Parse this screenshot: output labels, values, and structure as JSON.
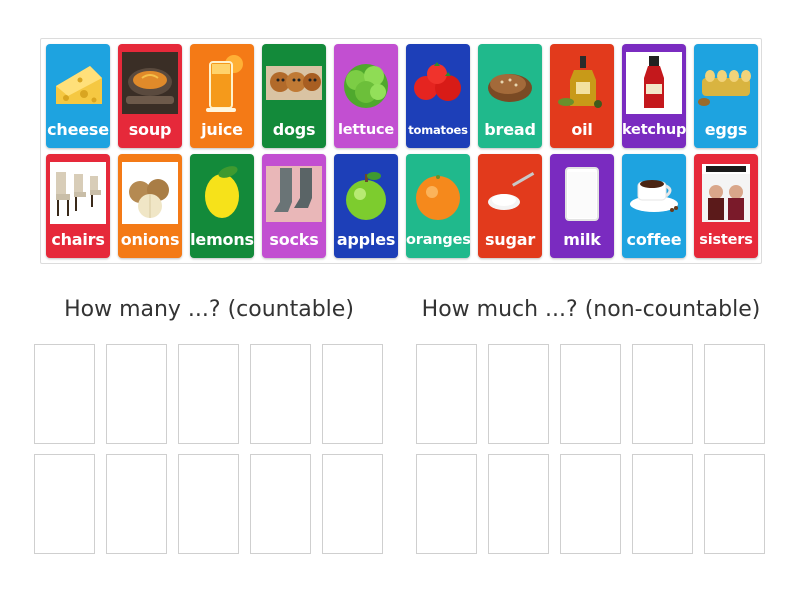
{
  "cards": [
    {
      "label": "cheese",
      "color": "#1ea3e0",
      "icon": "cheese-icon"
    },
    {
      "label": "soup",
      "color": "#e6293a",
      "icon": "soup-bowl-icon"
    },
    {
      "label": "juice",
      "color": "#f47a16",
      "icon": "juice-glass-icon"
    },
    {
      "label": "dogs",
      "color": "#138a3a",
      "icon": "dogs-icon"
    },
    {
      "label": "lettuce",
      "color": "#c24fd1",
      "icon": "lettuce-icon"
    },
    {
      "label": "tomatoes",
      "color": "#1d3fb8",
      "icon": "tomatoes-icon"
    },
    {
      "label": "bread",
      "color": "#20b98c",
      "icon": "bread-icon"
    },
    {
      "label": "oil",
      "color": "#e23a1c",
      "icon": "oil-bottle-icon"
    },
    {
      "label": "ketchup",
      "color": "#7a2bc0",
      "icon": "ketchup-bottle-icon"
    },
    {
      "label": "eggs",
      "color": "#1ea3e0",
      "icon": "eggs-carton-icon"
    },
    {
      "label": "chairs",
      "color": "#e6293a",
      "icon": "chairs-icon"
    },
    {
      "label": "onions",
      "color": "#f47a16",
      "icon": "onions-icon"
    },
    {
      "label": "lemons",
      "color": "#138a3a",
      "icon": "lemon-icon"
    },
    {
      "label": "socks",
      "color": "#c24fd1",
      "icon": "socks-icon"
    },
    {
      "label": "apples",
      "color": "#1d3fb8",
      "icon": "apple-icon"
    },
    {
      "label": "oranges",
      "color": "#20b98c",
      "icon": "orange-icon"
    },
    {
      "label": "sugar",
      "color": "#e23a1c",
      "icon": "sugar-spoon-icon"
    },
    {
      "label": "milk",
      "color": "#7a2bc0",
      "icon": "milk-glass-icon"
    },
    {
      "label": "coffee",
      "color": "#1ea3e0",
      "icon": "coffee-cup-icon"
    },
    {
      "label": "sisters",
      "color": "#e6293a",
      "icon": "magazine-cover-icon"
    }
  ],
  "groups": [
    {
      "heading": "How many ...? (countable)"
    },
    {
      "heading": "How much ...? (non-countable)"
    }
  ]
}
